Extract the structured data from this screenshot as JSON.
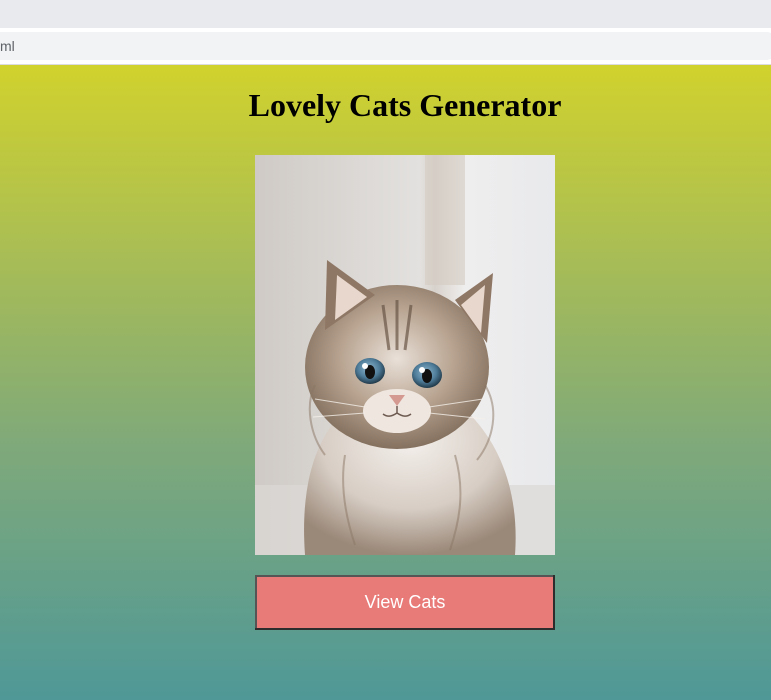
{
  "browser": {
    "url_fragment": "ml"
  },
  "page": {
    "title": "Lovely Cats Generator",
    "image_alt": "kitten",
    "button_label": "View Cats",
    "colors": {
      "gradient_top": "#d1d22d",
      "gradient_bottom": "#4f9897",
      "button_bg": "#e87a78",
      "button_text": "#ffffff"
    }
  }
}
